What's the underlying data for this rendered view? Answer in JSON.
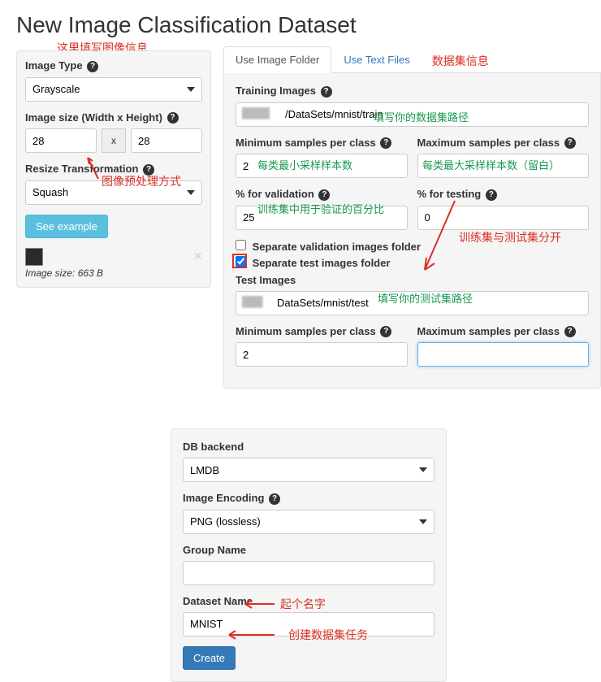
{
  "page_title": "New Image Classification Dataset",
  "annotations": {
    "top_left": "这里填写图像信息",
    "top_right": "数据集信息",
    "preprocess": "图像预处理方式",
    "path_hint": "填写你的数据集路径",
    "min_samples": "每类最小采样样本数",
    "max_samples": "每类最大采样样本数（留白）",
    "validation_pct": "训练集中用于验证的百分比",
    "split_hint": "训练集与测试集分开",
    "test_path_hint": "填写你的测试集路径",
    "name_hint": "起个名字",
    "create_hint": "创建数据集任务"
  },
  "left": {
    "image_type_label": "Image Type",
    "image_type_value": "Grayscale",
    "image_size_label": "Image size (Width x Height)",
    "width": "28",
    "height": "28",
    "resize_label": "Resize Transformation",
    "resize_value": "Squash",
    "see_example": "See example",
    "thumb_caption": "Image size: 663 B"
  },
  "tabs": {
    "folder": "Use Image Folder",
    "text": "Use Text Files"
  },
  "right": {
    "training_images_label": "Training Images",
    "training_images_value": "/DataSets/mnist/train",
    "min_samples_label": "Minimum samples per class",
    "min_samples_value": "2",
    "max_samples_label": "Maximum samples per class",
    "max_samples_value": "",
    "pct_validation_label": "% for validation",
    "pct_validation_value": "25",
    "pct_testing_label": "% for testing",
    "pct_testing_value": "0",
    "sep_validation_label": "Separate validation images folder",
    "sep_test_label": "Separate test images folder",
    "test_images_label": "Test Images",
    "test_images_value": "DataSets/mnist/test",
    "min_samples2_label": "Minimum samples per class",
    "min_samples2_value": "2",
    "max_samples2_label": "Maximum samples per class",
    "max_samples2_value": ""
  },
  "bottom": {
    "db_backend_label": "DB backend",
    "db_backend_value": "LMDB",
    "image_encoding_label": "Image Encoding",
    "image_encoding_value": "PNG (lossless)",
    "group_name_label": "Group Name",
    "group_name_value": "",
    "dataset_name_label": "Dataset Name",
    "dataset_name_value": "MNIST",
    "create_button": "Create"
  }
}
